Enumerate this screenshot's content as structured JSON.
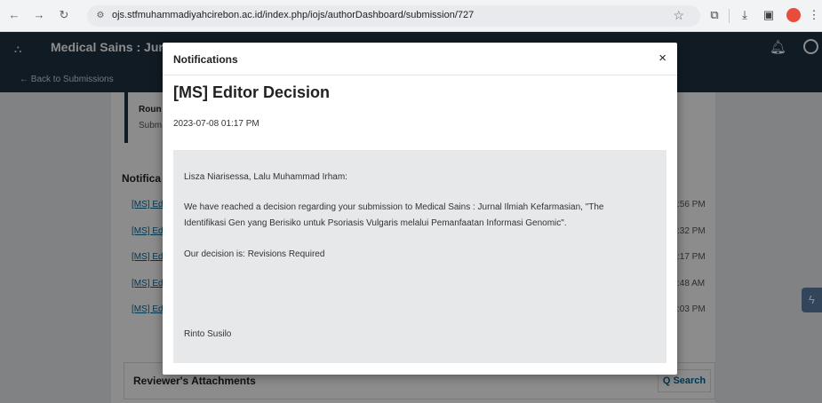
{
  "browser": {
    "url": "ojs.stfmuhammadiyahcirebon.ac.id/index.php/iojs/authorDashboard/submission/727"
  },
  "header": {
    "site_title": "Medical Sains : Jurnal",
    "back_link": "← Back to Submissions"
  },
  "background": {
    "round_label": "Roun",
    "round_sub": "Subm",
    "notifications_heading": "Notifica",
    "rows": [
      {
        "label": "[MS] Ed",
        "time": ":56 PM"
      },
      {
        "label": "[MS] Ed",
        "time": ":32 PM"
      },
      {
        "label": "[MS] Ed",
        "time": ":17 PM"
      },
      {
        "label": "[MS] Ed",
        "time": ":48 AM"
      },
      {
        "label": "[MS] Ed",
        "time": ":03 PM"
      }
    ],
    "attachments_title": "Reviewer's Attachments",
    "search_label": "Q Search"
  },
  "modal": {
    "title": "Notifications",
    "close": "×",
    "decision_title": "[MS] Editor Decision",
    "date": "2023-07-08 01:17 PM",
    "greeting": "Lisza Niarisessa, Lalu Muhammad Irham:",
    "body_line1": "We have reached a decision regarding your submission to Medical Sains : Jurnal Ilmiah Kefarmasian, \"The",
    "body_line2": "Identifikasi Gen yang Berisiko untuk Psoriasis Vulgaris melalui Pemanfaatan Informasi Genomic\".",
    "decision": "Our decision is: Revisions Required",
    "signature": "Rinto Susilo"
  }
}
